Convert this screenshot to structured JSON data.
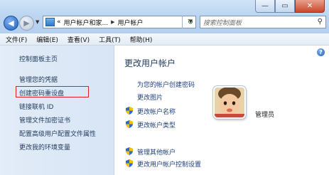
{
  "address": {
    "segments": [
      "«",
      "用户帐户和家...",
      "用户帐户"
    ]
  },
  "search": {
    "placeholder": "搜索控制面板"
  },
  "menu": [
    "文件(F)",
    "编辑(E)",
    "查看(V)",
    "工具(T)",
    "帮助(H)"
  ],
  "sidebar": {
    "home": "控制面板主页",
    "links": [
      "管理您的凭据",
      "创建密码重设盘",
      "链接联机 ID",
      "管理文件加密证书",
      "配置高级用户配置文件属性",
      "更改我的环境变量"
    ],
    "highlighted_index": 1
  },
  "main": {
    "title": "更改用户帐户",
    "tasks": [
      {
        "label": "为您的帐户创建密码",
        "shield": false
      },
      {
        "label": "更改图片",
        "shield": false
      },
      {
        "label": "更改帐户名称",
        "shield": true
      },
      {
        "label": "更改帐户类型",
        "shield": true
      },
      {
        "label": "管理其他帐户",
        "shield": true
      },
      {
        "label": "更改用户帐户控制设置",
        "shield": true
      }
    ],
    "user_name": "管理员"
  },
  "icons": {
    "back": "back-arrow-icon",
    "forward": "forward-arrow-icon",
    "refresh": "refresh-icon",
    "search": "search-icon",
    "help": "help-icon",
    "shield": "uac-shield-icon"
  },
  "colors": {
    "link": "#1e3f80",
    "title": "#1e395b",
    "sidebar_bg": "#dbe7f6",
    "highlight_border": "#e02020"
  }
}
